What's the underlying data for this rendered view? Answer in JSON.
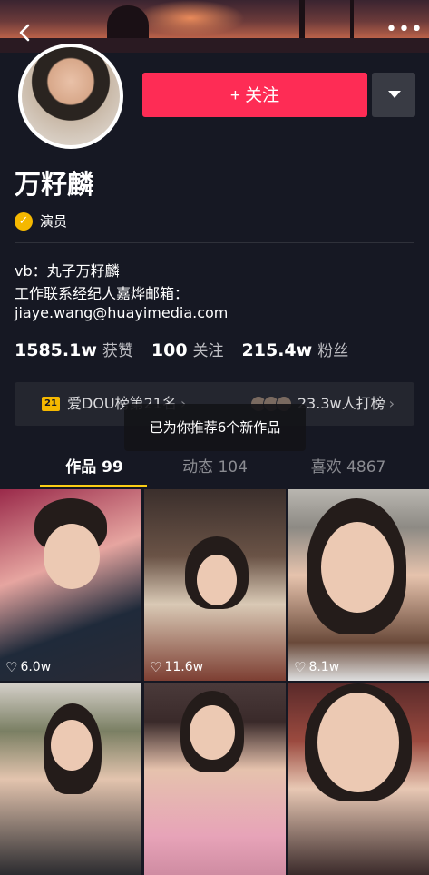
{
  "header": {
    "back_icon": "chevron-left-icon",
    "more_icon": "more-dots-icon",
    "more_glyph": "•••"
  },
  "profile": {
    "follow_label": "+ 关注",
    "name": "万籽麟",
    "verified_label": "演员",
    "verified_icon": "check-badge-icon",
    "bio_line1": "vb：丸子万籽麟",
    "bio_line2": "工作联系经纪人嘉烨邮箱：",
    "bio_line3": "jiaye.wang@huayimedia.com"
  },
  "stats": [
    {
      "value": "1585.1w",
      "label": "获赞"
    },
    {
      "value": "100",
      "label": "关注"
    },
    {
      "value": "215.4w",
      "label": "粉丝"
    }
  ],
  "rank": {
    "left_badge": "21",
    "left_text": "爱DOU榜第21名",
    "left_arrow": "›",
    "right_text": "23.3w人打榜",
    "right_arrow": "›"
  },
  "toast": "已为你推荐6个新作品",
  "tabs": [
    {
      "label": "作品 99",
      "active": true
    },
    {
      "label": "动态 104",
      "active": false
    },
    {
      "label": "喜欢 4867",
      "active": false
    }
  ],
  "videos": [
    {
      "likes": "6.0w"
    },
    {
      "likes": "11.6w"
    },
    {
      "likes": "8.1w"
    },
    {
      "likes": ""
    },
    {
      "likes": ""
    },
    {
      "likes": ""
    }
  ],
  "colors": {
    "background": "#161823",
    "follow": "#fe2c55",
    "tab_underline": "#face15",
    "verify_badge": "#f5b800"
  }
}
